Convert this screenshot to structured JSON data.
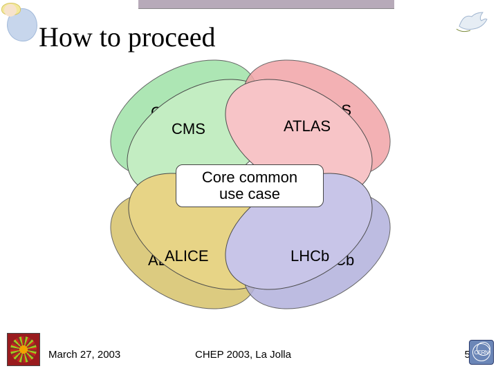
{
  "title": "How to proceed",
  "diagram": {
    "top_left": {
      "label_back": "CMS",
      "label_front": "CMS",
      "color_back": "#9fe2a7",
      "color_front": "#c3edc2"
    },
    "top_right": {
      "label_back": "ATLAS",
      "label_front": "ATLAS",
      "color_back": "#f2a4a8",
      "color_front": "#f7c4c7"
    },
    "bottom_left": {
      "label_back": "ALICE",
      "label_front": "ALICE",
      "color_back": "#d6c26b",
      "color_front": "#e7d486"
    },
    "bottom_right": {
      "label_back": "LHCb",
      "label_front": "LHCb",
      "color_back": "#b2b1dc",
      "color_front": "#c8c5e8"
    },
    "center": "Core common\nuse case"
  },
  "footer": {
    "date": "March 27, 2003",
    "venue": "CHEP 2003, La Jolla",
    "page": "5",
    "cern_label": "CERN"
  }
}
